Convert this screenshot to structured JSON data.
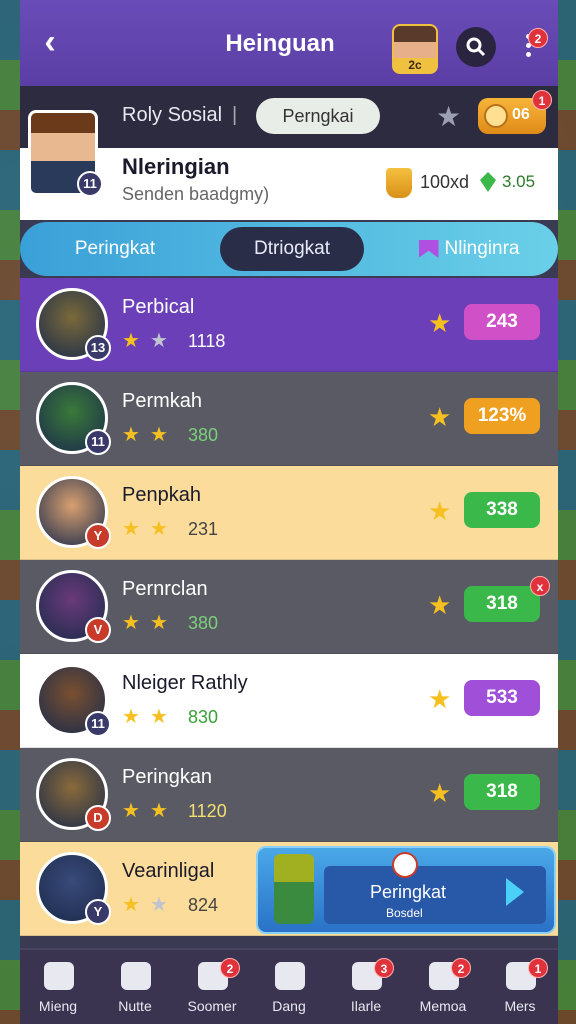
{
  "header": {
    "back_glyph": "‹",
    "title": "Heinguan",
    "avatar_text": "2c",
    "notif_badge": "2"
  },
  "subbar": {
    "label": "Roly Sosial",
    "separator": "|",
    "pill": "Perngkai",
    "coins": "06",
    "coins_badge": "1"
  },
  "profile": {
    "name": "Nleringian",
    "subtitle": "Senden baadgmy)",
    "level": "11",
    "score": "100xd",
    "gems": "3.05"
  },
  "tabs": [
    {
      "label": "Peringkat"
    },
    {
      "label": "Dtriogkat"
    },
    {
      "label": "Nlinginra"
    }
  ],
  "leaderboard": [
    {
      "name": "Perbical",
      "level": "13",
      "stars": 1,
      "subvalue": "1118",
      "value": "243",
      "bg": "#6a3fb8",
      "name_color": "#ffffff",
      "sub_color": "#ffffff",
      "pill_color": "#d050c8",
      "lvl_color": "#3a3a6a",
      "second_star_grey": true,
      "avatar": "#7a6a3a"
    },
    {
      "name": "Permkah",
      "level": "11",
      "stars": 2,
      "subvalue": "380",
      "value": "123%",
      "bg": "#5a5a64",
      "name_color": "#ffffff",
      "sub_color": "#7ad07a",
      "pill_color": "#f0a020",
      "lvl_color": "#3a3a6a",
      "second_star_grey": false,
      "avatar": "#3a7a3a"
    },
    {
      "name": "Penpkah",
      "level": "Y",
      "stars": 2,
      "subvalue": "231",
      "value": "338",
      "bg": "#fbdc9a",
      "name_color": "#1a1a2a",
      "sub_color": "#444444",
      "pill_color": "#3ab84a",
      "lvl_color": "#c83a2a",
      "second_star_grey": false,
      "avatar": "#d8a070"
    },
    {
      "name": "Pernrclan",
      "level": "V",
      "stars": 2,
      "subvalue": "380",
      "value": "318",
      "bg": "#5a5a64",
      "name_color": "#ffffff",
      "sub_color": "#7ad07a",
      "pill_color": "#3ab84a",
      "lvl_color": "#c83a2a",
      "second_star_grey": false,
      "avatar": "#6a3a7a",
      "pill_badge": "x"
    },
    {
      "name": "Nleiger Rathly",
      "level": "11",
      "stars": 2,
      "subvalue": "830",
      "value": "533",
      "bg": "#ffffff",
      "name_color": "#1a1a2a",
      "sub_color": "#3aa03a",
      "pill_color": "#a050d8",
      "lvl_color": "#3a3a6a",
      "second_star_grey": false,
      "avatar": "#7a5030"
    },
    {
      "name": "Peringkan",
      "level": "D",
      "stars": 2,
      "subvalue": "1120",
      "value": "318",
      "bg": "#5a5a64",
      "name_color": "#ffffff",
      "sub_color": "#f0e070",
      "pill_color": "#3ab84a",
      "lvl_color": "#c83a2a",
      "second_star_grey": false,
      "avatar": "#8a6a3a"
    },
    {
      "name": "Vearinligal",
      "level": "Y",
      "stars": 1,
      "subvalue": "824",
      "value": "",
      "bg": "#fbdc9a",
      "name_color": "#1a1a2a",
      "sub_color": "#444444",
      "pill_color": "",
      "lvl_color": "#3a3a6a",
      "second_star_grey": true,
      "avatar": "#3a4a7a"
    }
  ],
  "cta": {
    "label": "Peringkat",
    "sub": "Bosdel"
  },
  "nav": [
    {
      "label": "Mieng",
      "icon": "home-icon",
      "badge": ""
    },
    {
      "label": "Nutte",
      "icon": "tools-icon",
      "badge": ""
    },
    {
      "label": "Soomer",
      "icon": "flag-icon",
      "badge": "2"
    },
    {
      "label": "Dang",
      "icon": "shield-icon",
      "badge": ""
    },
    {
      "label": "Ilarle",
      "icon": "dice-icon",
      "badge": "3"
    },
    {
      "label": "Memoa",
      "icon": "gamepad-icon",
      "badge": "2"
    },
    {
      "label": "Mers",
      "icon": "mail-icon",
      "badge": "1"
    }
  ]
}
